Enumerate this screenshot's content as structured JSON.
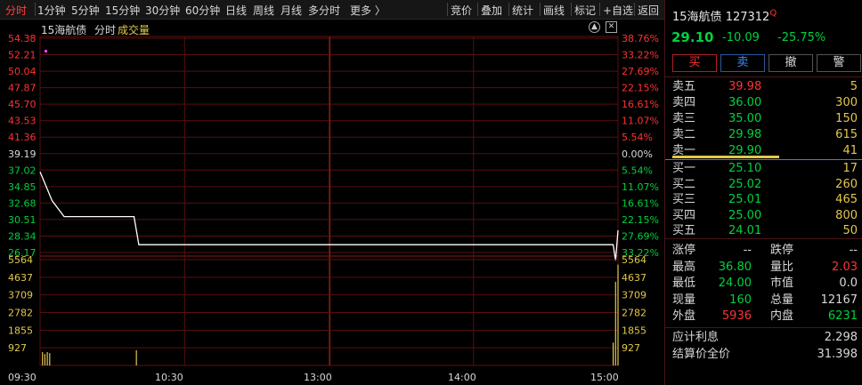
{
  "toolbar": {
    "periods": [
      "分时",
      "1分钟",
      "5分钟",
      "15分钟",
      "30分钟",
      "60分钟",
      "日线",
      "周线",
      "月线",
      "多分时",
      "更多 〉"
    ],
    "active": "分时",
    "tools": [
      "竞价",
      "叠加",
      "统计",
      "画线",
      "标记",
      "+自选",
      "返回"
    ]
  },
  "chart_header": {
    "name": "15海航债",
    "mode": "分时",
    "volume_label": "成交量"
  },
  "chart_data": {
    "type": "line",
    "title": "15海航债 分时",
    "prev_close": 39.19,
    "price_ticks_left": [
      "54.38",
      "52.21",
      "50.04",
      "47.87",
      "45.70",
      "43.53",
      "41.36",
      "39.19",
      "37.02",
      "34.85",
      "32.68",
      "30.51",
      "28.34",
      "26.17"
    ],
    "pct_ticks_right": [
      "38.76%",
      "33.22%",
      "27.69%",
      "22.15%",
      "16.61%",
      "11.07%",
      "5.54%",
      "0.00%",
      "5.54%",
      "11.07%",
      "16.61%",
      "22.15%",
      "27.69%",
      "33.22%"
    ],
    "ylim": [
      26.17,
      54.38
    ],
    "time_ticks": [
      "09:30",
      "10:30",
      "13:00",
      "14:00",
      "15:00"
    ],
    "price_series": [
      {
        "t": "09:30",
        "v": 36.8
      },
      {
        "t": "09:35",
        "v": 33.0
      },
      {
        "t": "09:40",
        "v": 30.9
      },
      {
        "t": "10:09",
        "v": 30.9
      },
      {
        "t": "10:11",
        "v": 27.2
      },
      {
        "t": "11:30",
        "v": 27.2
      },
      {
        "t": "14:58",
        "v": 27.2
      },
      {
        "t": "14:59",
        "v": 25.1
      },
      {
        "t": "15:00",
        "v": 29.1
      }
    ],
    "volume_ticks": [
      "5564",
      "4637",
      "3709",
      "2782",
      "1855",
      "927"
    ],
    "vol_max": 5564,
    "volume_bars": [
      {
        "t": "09:31",
        "v": 700
      },
      {
        "t": "09:32",
        "v": 600
      },
      {
        "t": "09:33",
        "v": 700
      },
      {
        "t": "09:34",
        "v": 650
      },
      {
        "t": "10:10",
        "v": 800
      },
      {
        "t": "14:58",
        "v": 1200
      },
      {
        "t": "14:59",
        "v": 4400
      },
      {
        "t": "15:00",
        "v": 5300
      }
    ],
    "colors": {
      "up": "#ff3333",
      "down": "#00d23c",
      "neutral": "#d8d8d8",
      "volume": "#e2c84a",
      "grid": "#5a0f0f",
      "line": "#ffffff"
    }
  },
  "quote": {
    "name": "15海航债",
    "code": "127312",
    "flag": "Q",
    "price": "29.10",
    "change": "-10.09",
    "change_pct": "-25.75%"
  },
  "actions": {
    "buy": "买",
    "sell": "卖",
    "cancel": "撤",
    "alert": "警"
  },
  "asks": [
    {
      "label": "卖五",
      "price": "39.98",
      "vol": "5",
      "dir": "up"
    },
    {
      "label": "卖四",
      "price": "36.00",
      "vol": "300",
      "dir": "down"
    },
    {
      "label": "卖三",
      "price": "35.00",
      "vol": "150",
      "dir": "down"
    },
    {
      "label": "卖二",
      "price": "29.98",
      "vol": "615",
      "dir": "down"
    },
    {
      "label": "卖一",
      "price": "29.90",
      "vol": "41",
      "dir": "down"
    }
  ],
  "bids": [
    {
      "label": "买一",
      "price": "25.10",
      "vol": "17",
      "dir": "down"
    },
    {
      "label": "买二",
      "price": "25.02",
      "vol": "260",
      "dir": "down"
    },
    {
      "label": "买三",
      "price": "25.01",
      "vol": "465",
      "dir": "down"
    },
    {
      "label": "买四",
      "price": "25.00",
      "vol": "800",
      "dir": "down"
    },
    {
      "label": "买五",
      "price": "24.01",
      "vol": "50",
      "dir": "down"
    }
  ],
  "stats": [
    {
      "k1": "涨停",
      "v1": "--",
      "c1": "neutral",
      "k2": "跌停",
      "v2": "--",
      "c2": "neutral"
    },
    {
      "k1": "最高",
      "v1": "36.80",
      "c1": "down",
      "k2": "量比",
      "v2": "2.03",
      "c2": "up"
    },
    {
      "k1": "最低",
      "v1": "24.00",
      "c1": "down",
      "k2": "市值",
      "v2": "0.0",
      "c2": "neutral"
    },
    {
      "k1": "现量",
      "v1": "160",
      "c1": "down",
      "k2": "总量",
      "v2": "12167",
      "c2": "neutral"
    },
    {
      "k1": "外盘",
      "v1": "5936",
      "c1": "up",
      "k2": "内盘",
      "v2": "6231",
      "c2": "down"
    }
  ],
  "bond": [
    {
      "k": "应计利息",
      "v": "2.298"
    },
    {
      "k": "结算价全价",
      "v": "31.398"
    }
  ]
}
